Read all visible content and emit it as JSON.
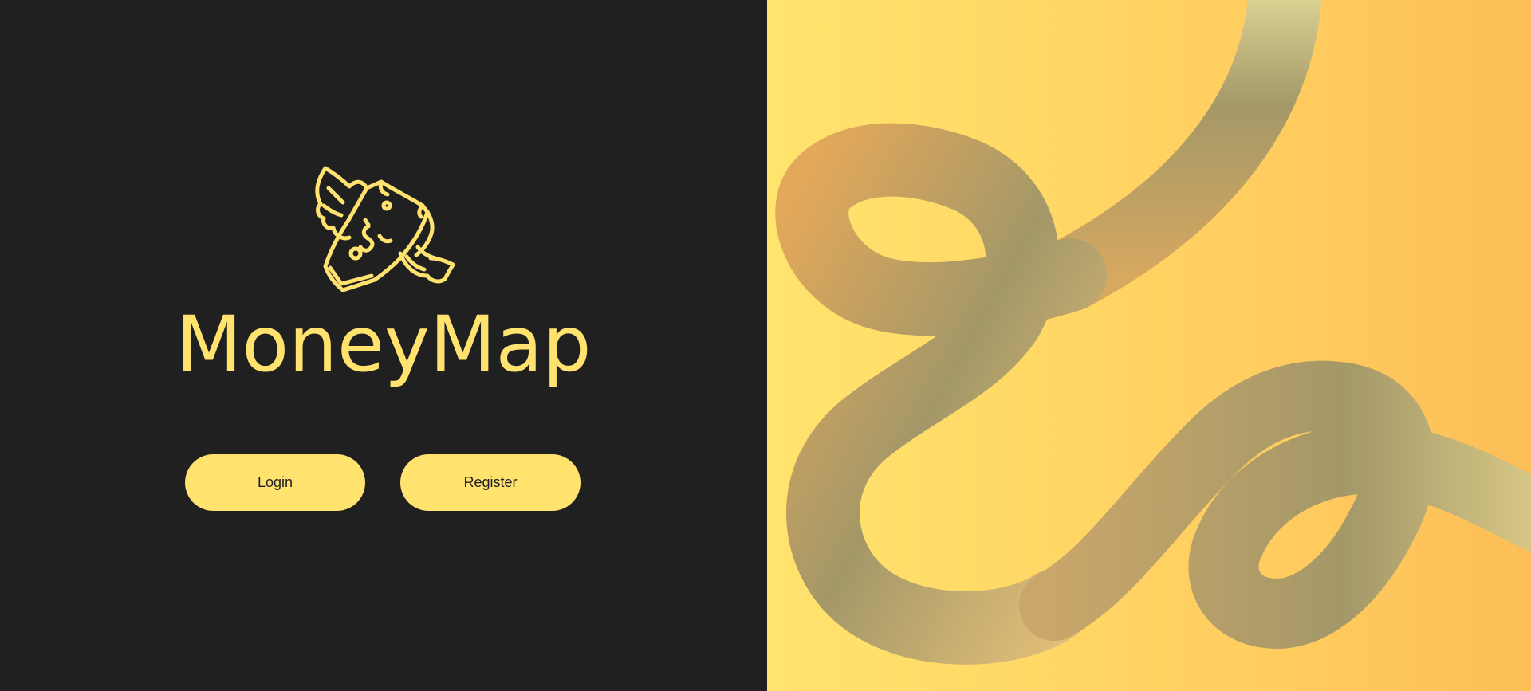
{
  "brand": {
    "name": "MoneyMap",
    "icon": "flying-money-icon",
    "accent_color": "#FFE36E",
    "background_color": "#202020"
  },
  "actions": {
    "login_label": "Login",
    "register_label": "Register"
  },
  "hero": {
    "illustration": "abstract-ribbon-graphic",
    "gradient_start": "#FFE46E",
    "gradient_end": "#FDBE58",
    "ribbon_color": "#A89A68"
  }
}
